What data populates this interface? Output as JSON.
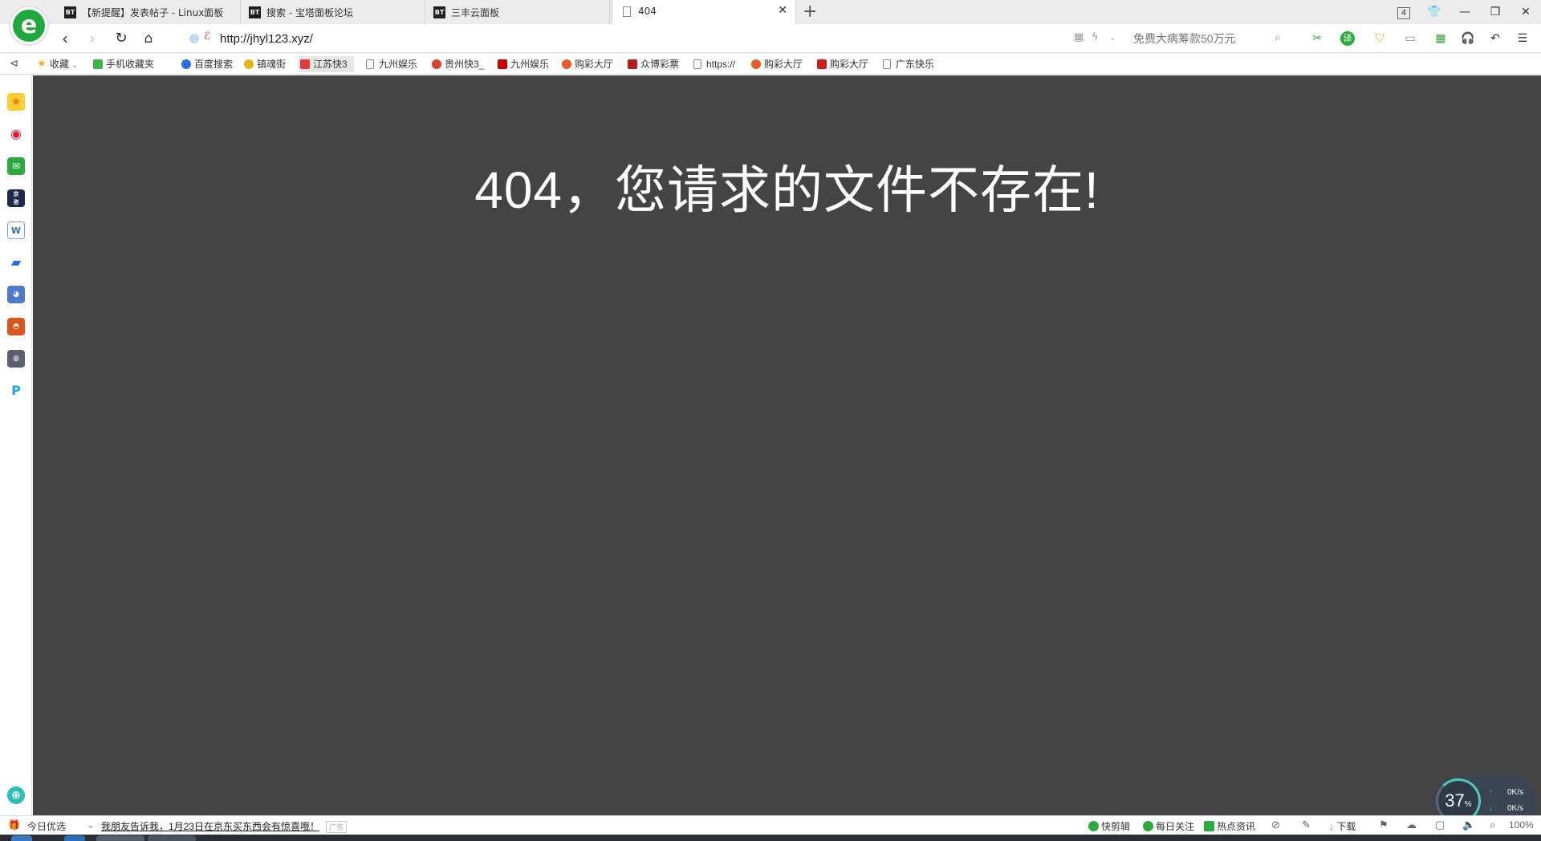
{
  "tabs": [
    {
      "label": "【新提醒】发表帖子 - Linux面板",
      "icon": "BT"
    },
    {
      "label": "搜索 - 宝塔面板论坛",
      "icon": "BT"
    },
    {
      "label": "三丰云面板",
      "icon": "BT"
    },
    {
      "label": "404",
      "icon": "page"
    }
  ],
  "window": {
    "tab_count": "4"
  },
  "address": {
    "url": "http://jhyl123.xyz/"
  },
  "search": {
    "placeholder": "免费大病筹款50万元"
  },
  "bookmarks": [
    {
      "label": "收藏",
      "icon": "star",
      "color": "#f2b31b"
    },
    {
      "label": "手机收藏夹",
      "icon": "phone",
      "color": "#3cb44b"
    },
    {
      "label": "百度搜索",
      "icon": "paw",
      "color": "#2a6fe0"
    },
    {
      "label": "镇魂街",
      "icon": "play",
      "color": "#e8b21a"
    },
    {
      "label": "江苏快3",
      "icon": "dice",
      "color": "#e03a3a"
    },
    {
      "label": "九州娱乐",
      "icon": "doc",
      "color": "#888888"
    },
    {
      "label": "贵州快3_",
      "icon": "swirl",
      "color": "#e03a3a"
    },
    {
      "label": "九州娱乐",
      "icon": "v-logo",
      "color": "#c00000"
    },
    {
      "label": "购彩大厅",
      "icon": "circle",
      "color": "#e55b2b"
    },
    {
      "label": "众博彩票",
      "icon": "square",
      "color": "#b21d1d"
    },
    {
      "label": "https://",
      "icon": "doc",
      "color": "#888888"
    },
    {
      "label": "购彩大厅",
      "icon": "circle",
      "color": "#e55b2b"
    },
    {
      "label": "购彩大厅",
      "icon": "grid",
      "color": "#cc2222"
    },
    {
      "label": "广东快乐",
      "icon": "doc",
      "color": "#888888"
    }
  ],
  "content": {
    "message": "404，您请求的文件不存在!",
    "background": "#444444"
  },
  "speed_widget": {
    "percent": "37",
    "percent_unit": "%",
    "upload": "0K/s",
    "download": "0K/s"
  },
  "status": {
    "today": "今日优选",
    "news": "我朋友告诉我，1月23日在京东买东西会有惊喜哦！",
    "quick_clip": "快剪辑",
    "daily_follow": "每日关注",
    "hot_news": "热点资讯",
    "download": "下载",
    "zoom": "100%"
  }
}
